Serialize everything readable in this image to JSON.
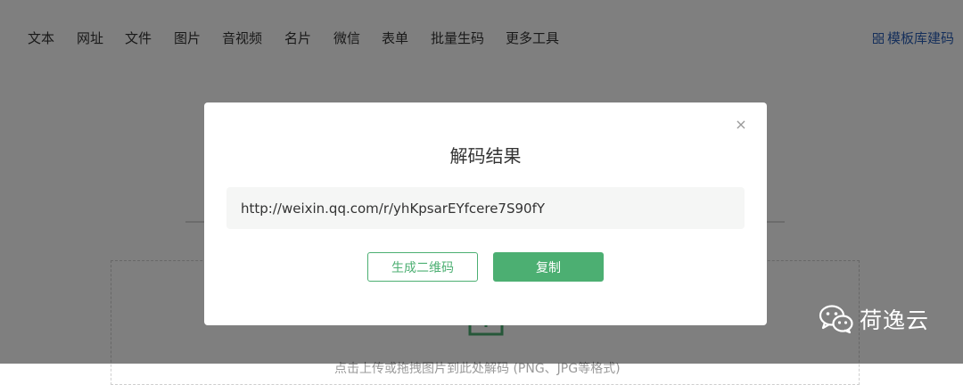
{
  "nav": {
    "items": [
      {
        "label": "文本"
      },
      {
        "label": "网址"
      },
      {
        "label": "文件"
      },
      {
        "label": "图片"
      },
      {
        "label": "音视频"
      },
      {
        "label": "名片"
      },
      {
        "label": "微信"
      },
      {
        "label": "表单"
      },
      {
        "label": "批量生码"
      },
      {
        "label": "更多工具"
      }
    ],
    "template_link": "模板库建码",
    "template_icon": "grid-icon"
  },
  "upload": {
    "icon": "upload-icon",
    "hint": "点击上传或拖拽图片到此处解码 (PNG、JPG等格式)"
  },
  "modal": {
    "title": "解码结果",
    "close_label": "×",
    "result_text": "http://weixin.qq.com/r/yhKpsarEYfcere7S90fY",
    "generate_button": "生成二维码",
    "copy_button": "复制"
  },
  "watermark": {
    "icon": "wechat-icon",
    "text": "荷逸云"
  },
  "colors": {
    "accent_green": "#4caf72",
    "link_blue": "#2a5fb6",
    "overlay": "rgba(0,0,0,0.5)"
  }
}
